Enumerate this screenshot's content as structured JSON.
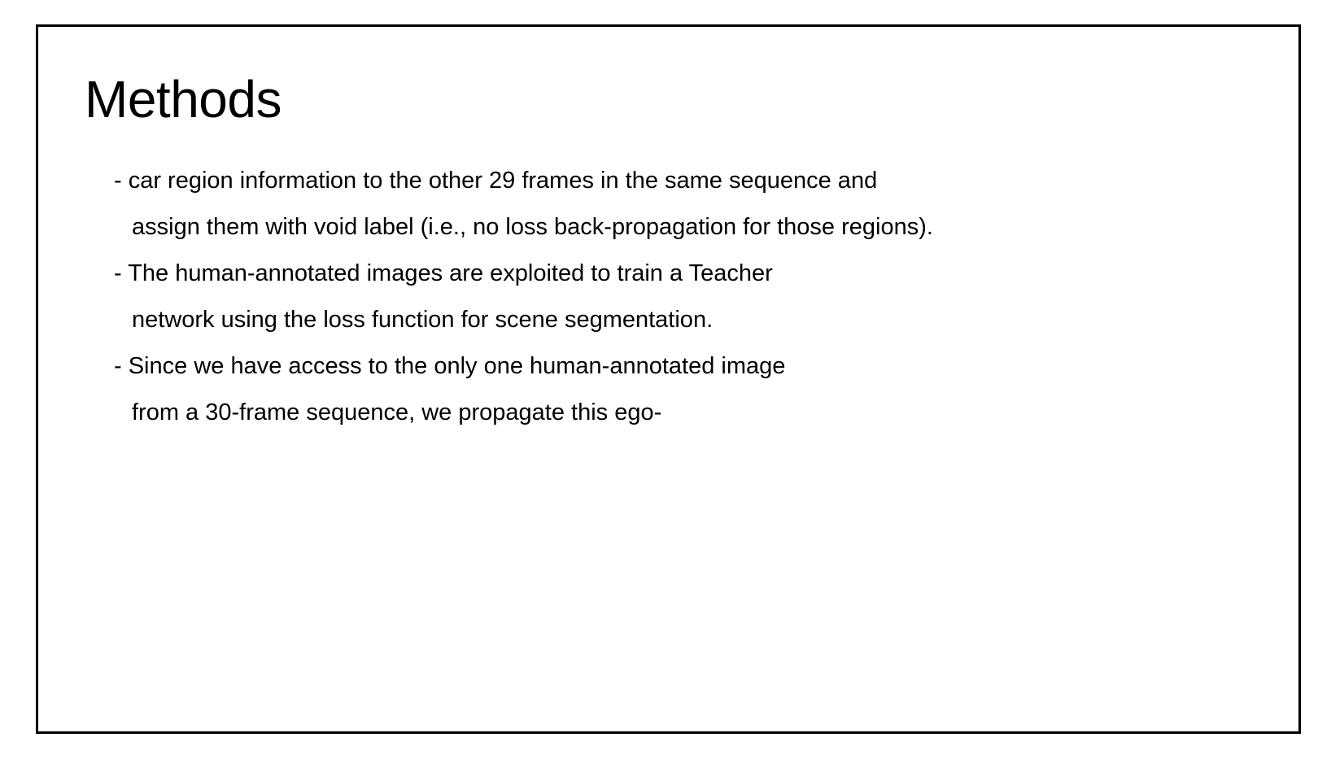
{
  "slide": {
    "title": "Methods",
    "lines": [
      {
        "text": "- car region information to the other 29 frames in the same sequence and",
        "kind": "bullet"
      },
      {
        "text": "assign them with void label (i.e., no loss back-propagation for those regions).",
        "kind": "continuation"
      },
      {
        "text": "- The human-annotated images are exploited to train a Teacher",
        "kind": "bullet"
      },
      {
        "text": "network using the loss function for scene segmentation.",
        "kind": "continuation"
      },
      {
        "text": "- Since we have access to the only one human-annotated image",
        "kind": "bullet"
      },
      {
        "text": "from a 30-frame sequence, we propagate this ego-",
        "kind": "continuation"
      }
    ]
  },
  "colors": {
    "border": "#000000",
    "text": "#000000",
    "background": "#ffffff"
  }
}
